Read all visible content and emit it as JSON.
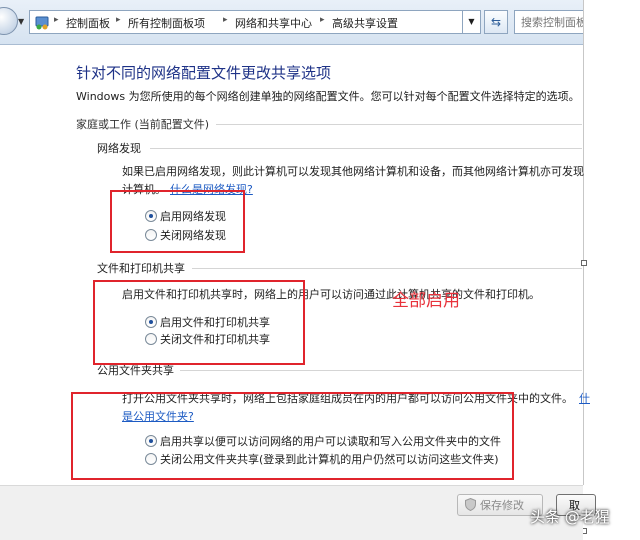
{
  "addressbar": {
    "crumbs": [
      "控制面板",
      "所有控制面板项",
      "网络和共享中心",
      "高级共享设置"
    ],
    "search_placeholder": "搜索控制面板"
  },
  "page": {
    "title": "针对不同的网络配置文件更改共享选项",
    "description": "Windows 为您所使用的每个网络创建单独的网络配置文件。您可以针对每个配置文件选择特定的选项。",
    "profile_group": "家庭或工作 (当前配置文件)"
  },
  "network_discovery": {
    "heading": "网络发现",
    "text_line1": "如果已启用网络发现，则此计算机可以发现其他网络计算机和设备，而其他网络计算机亦可发现",
    "text_line2_prefix": "计算机。",
    "link": "什么是网络发现?",
    "options": [
      {
        "label": "启用网络发现",
        "selected": true
      },
      {
        "label": "关闭网络发现",
        "selected": false
      }
    ]
  },
  "file_printer_sharing": {
    "heading": "文件和打印机共享",
    "text": "启用文件和打印机共享时，网络上的用户可以访问通过此计算机共享的文件和打印机。",
    "options": [
      {
        "label": "启用文件和打印机共享",
        "selected": true
      },
      {
        "label": "关闭文件和打印机共享",
        "selected": false
      }
    ]
  },
  "public_folder_sharing": {
    "heading": "公用文件夹共享",
    "text_line1": "打开公用文件夹共享时，网络上包括家庭组成员在内的用户都可以访问公用文件夹中的文件。",
    "link_line1": "什",
    "link_line2": "是公用文件夹?",
    "options": [
      {
        "label": "启用共享以便可以访问网络的用户可以读取和写入公用文件夹中的文件",
        "selected": true
      },
      {
        "label": "关闭公用文件夹共享(登录到此计算机的用户仍然可以访问这些文件夹)",
        "selected": false
      }
    ]
  },
  "annotation": "全部启用",
  "buttons": {
    "save": "保存修改",
    "cancel": "取"
  },
  "watermark": "头条 @老猩",
  "colors": {
    "title": "#1e3287",
    "link": "#1d5bc3",
    "highlight_box": "#e0242c"
  }
}
